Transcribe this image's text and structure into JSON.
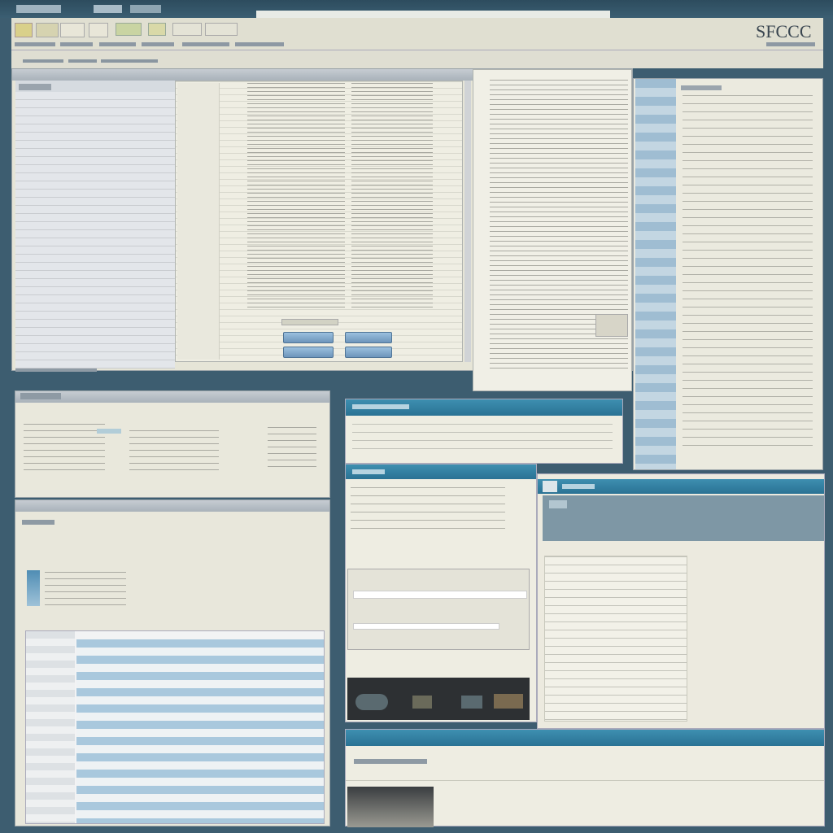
{
  "app": {
    "window_title": "",
    "logo_text": "SFCCC",
    "accent_color": "#2f7ea3",
    "bg_color": "#3d5d70"
  },
  "toolbar": {
    "tab_label": "",
    "menu_items": [
      "",
      "",
      "",
      "",
      "",
      ""
    ],
    "icons": [
      "toolbar-icon-1",
      "toolbar-icon-2",
      "toolbar-icon-3",
      "toolbar-icon-4"
    ]
  },
  "main_window": {
    "list_header": "",
    "rows": [
      "",
      "",
      "",
      "",
      "",
      "",
      "",
      "",
      "",
      "",
      "",
      "",
      "",
      "",
      "",
      "",
      "",
      "",
      "",
      "",
      "",
      "",
      "",
      "",
      ""
    ],
    "buttons": [
      "",
      "",
      "",
      ""
    ],
    "status_text": ""
  },
  "right_panel": {
    "title": "",
    "items": [
      "",
      "",
      "",
      "",
      "",
      "",
      "",
      "",
      "",
      "",
      "",
      "",
      "",
      "",
      ""
    ]
  },
  "mid_left_dialog": {
    "title": "",
    "label": ""
  },
  "teal_panel_a": {
    "title": ""
  },
  "teal_panel_b": {
    "title": ""
  },
  "teal_panel_c": {
    "title": ""
  },
  "teal_panel_d": {
    "title": "",
    "subtitle": ""
  },
  "lower_left": {
    "title": ""
  }
}
